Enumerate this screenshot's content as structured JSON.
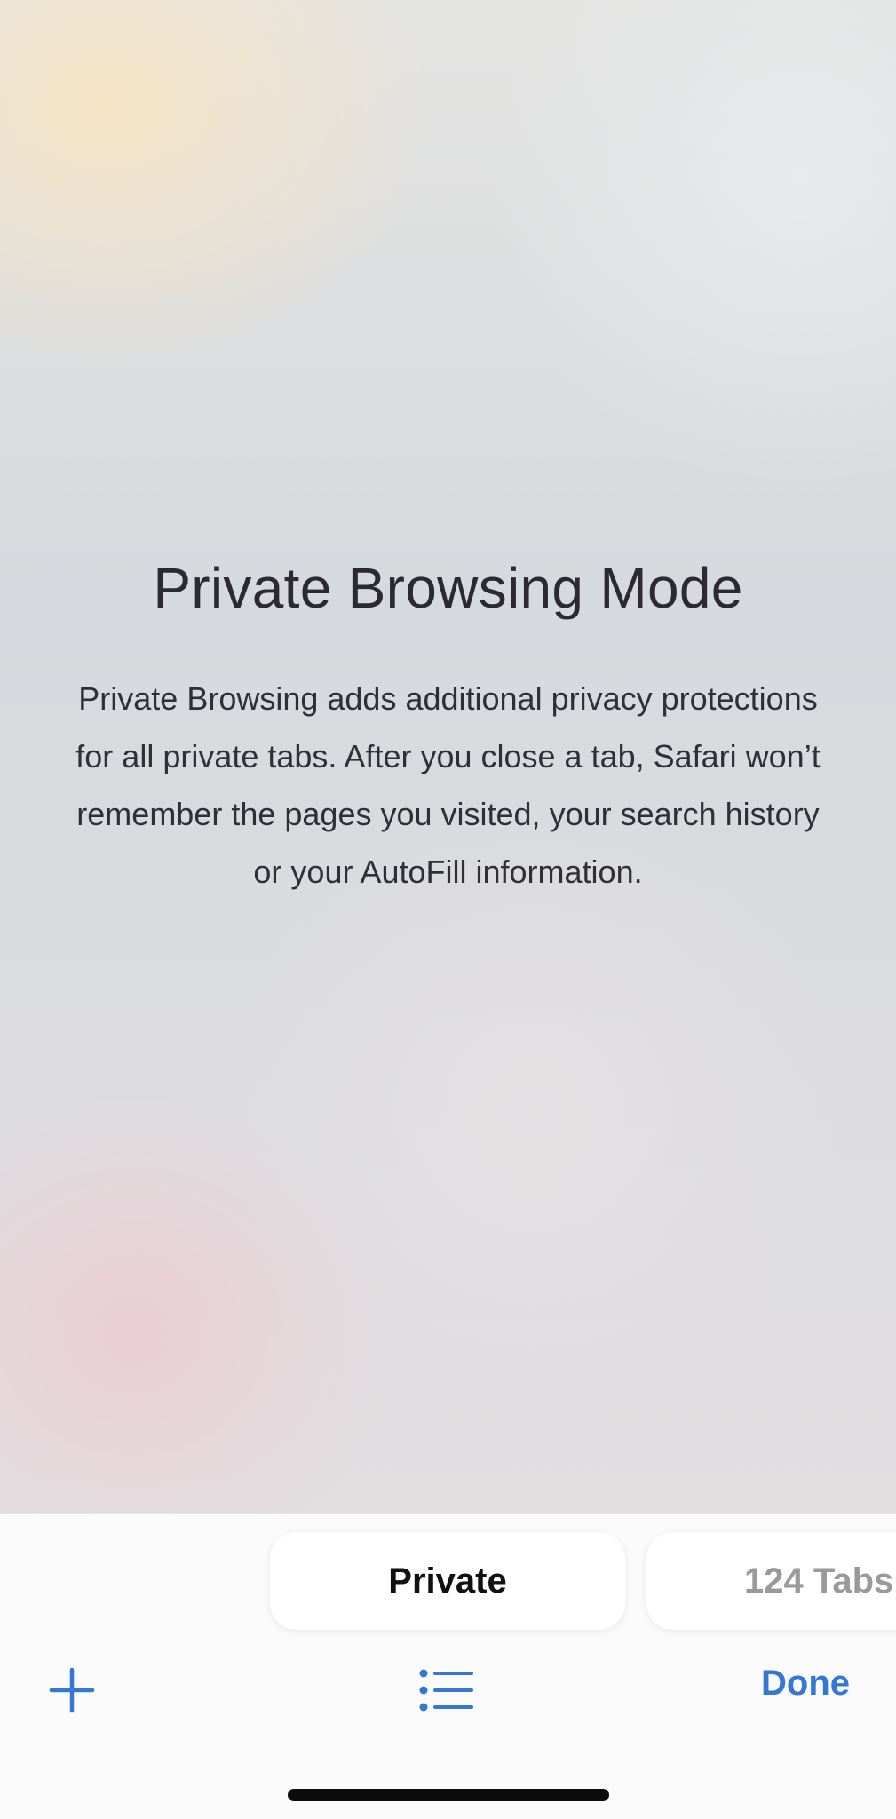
{
  "private_page": {
    "title": "Private Browsing Mode",
    "description": "Private Browsing adds additional privacy protections for all private tabs. After you close a tab, Safari won’t remember the pages you visited, your search history or your AutoFill information."
  },
  "tab_switcher": {
    "private_label": "Private",
    "tabs_label": "124 Tabs"
  },
  "toolbar": {
    "add_icon": "plus-icon",
    "list_icon": "list-icon",
    "done_label": "Done"
  },
  "colors": {
    "accent": "#3478d4",
    "inactive_label": "#9a9a9e"
  }
}
